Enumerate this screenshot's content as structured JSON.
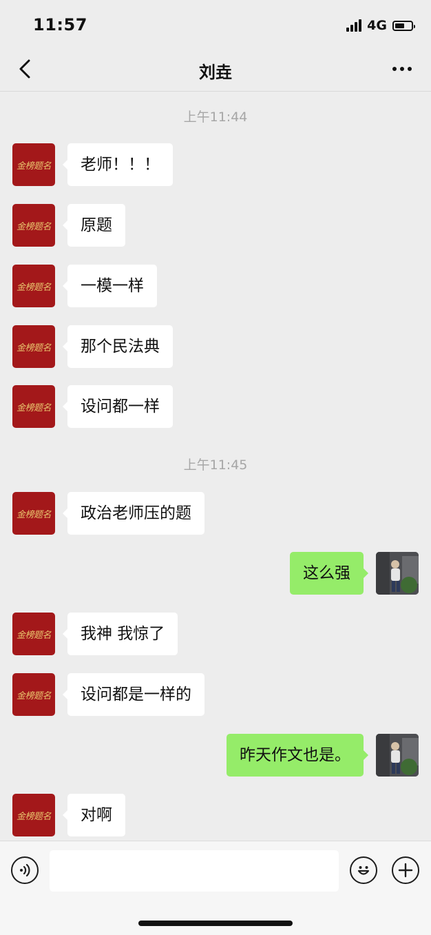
{
  "status_bar": {
    "time": "11:57",
    "network": "4G",
    "battery_level": 0.6
  },
  "nav": {
    "title": "刘垚",
    "back_icon": "chevron-left-icon",
    "more_icon": "more-dots-icon"
  },
  "contact": {
    "avatar_text": "金榜题名",
    "avatar_color": "#a3181a"
  },
  "timestamps": [
    "上午11:44",
    "上午11:45"
  ],
  "messages": [
    {
      "side": "in",
      "text": "老师！！！"
    },
    {
      "side": "in",
      "text": "原题"
    },
    {
      "side": "in",
      "text": "一模一样"
    },
    {
      "side": "in",
      "text": "那个民法典"
    },
    {
      "side": "in",
      "text": "设问都一样"
    },
    {
      "side": "in",
      "text": "政治老师压的题"
    },
    {
      "side": "out",
      "text": "这么强"
    },
    {
      "side": "in",
      "text": "我神 我惊了"
    },
    {
      "side": "in",
      "text": "设问都是一样的"
    },
    {
      "side": "out",
      "text": "昨天作文也是。"
    },
    {
      "side": "in",
      "text": "对啊"
    }
  ],
  "input_bar": {
    "voice_icon": "voice-icon",
    "emoji_icon": "emoji-icon",
    "plus_icon": "plus-icon",
    "input_value": ""
  },
  "colors": {
    "background": "#ededed",
    "bubble_in": "#ffffff",
    "bubble_out": "#95ec69"
  }
}
